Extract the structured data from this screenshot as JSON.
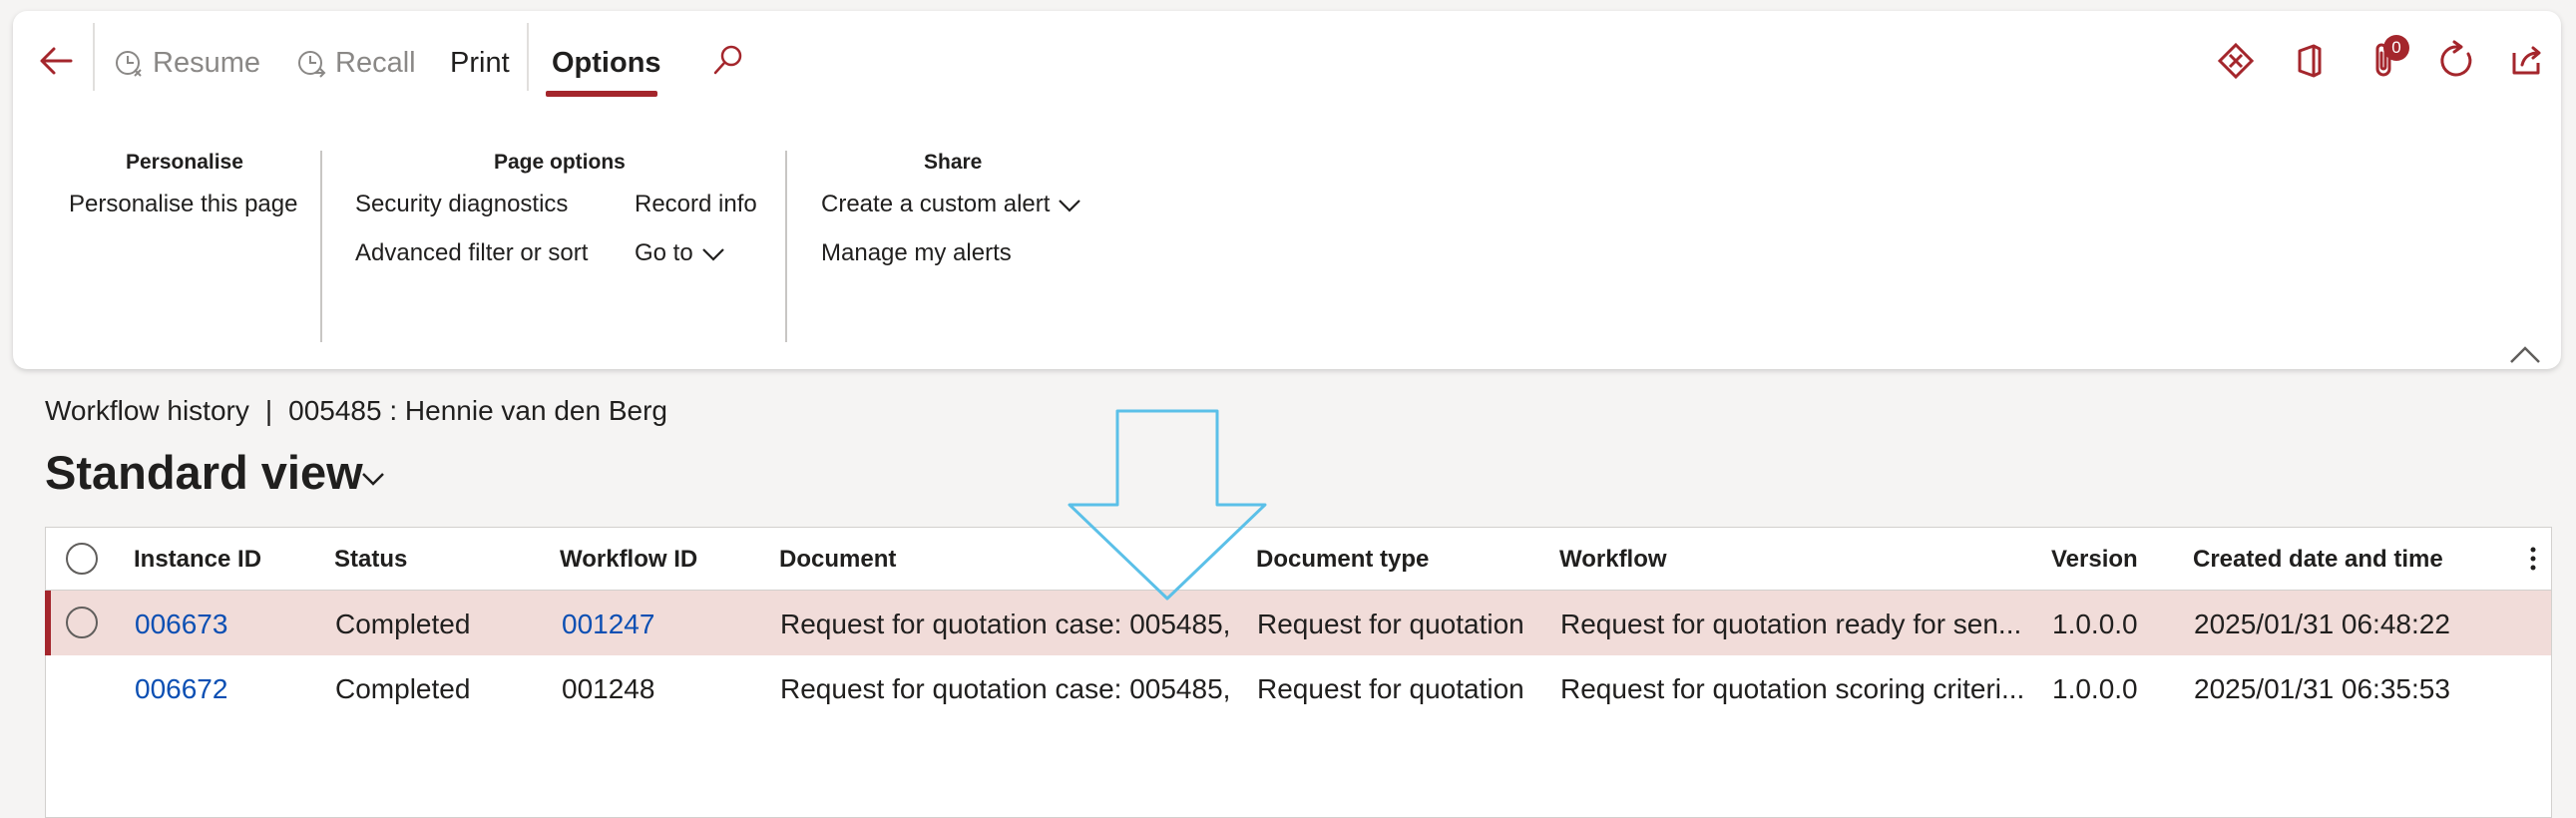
{
  "action_pane": {
    "tabs": [
      {
        "label": "Resume"
      },
      {
        "label": "Recall"
      },
      {
        "label": "Print"
      },
      {
        "label": "Options"
      }
    ],
    "groups": {
      "personalise": {
        "title": "Personalise",
        "items": [
          "Personalise this page"
        ]
      },
      "page_options": {
        "title": "Page options",
        "items": [
          "Security diagnostics",
          "Advanced filter or sort",
          "Record info",
          "Go to"
        ]
      },
      "share": {
        "title": "Share",
        "items": [
          "Create a custom alert",
          "Manage my alerts"
        ]
      }
    },
    "attachment_count": "0",
    "accent_color": "#a4262c"
  },
  "header": {
    "breadcrumb_page": "Workflow history",
    "breadcrumb_separator": "|",
    "breadcrumb_record": "005485 : Hennie van den Berg",
    "view_name": "Standard view"
  },
  "grid": {
    "columns": [
      "Instance ID",
      "Status",
      "Workflow ID",
      "Document",
      "Document type",
      "Workflow",
      "Version",
      "Created date and time"
    ],
    "rows": [
      {
        "instance_id": "006673",
        "status": "Completed",
        "workflow_id": "001247",
        "document": "Request for quotation case: 005485,",
        "document_type": "Request for quotation",
        "workflow": "Request for quotation ready for sen...",
        "version": "1.0.0.0",
        "created": "2025/01/31 06:48:22"
      },
      {
        "instance_id": "006672",
        "status": "Completed",
        "workflow_id": "001248",
        "document": "Request for quotation case: 005485,",
        "document_type": "Request for quotation",
        "workflow": "Request for quotation scoring criteri...",
        "version": "1.0.0.0",
        "created": "2025/01/31 06:35:53"
      }
    ]
  }
}
